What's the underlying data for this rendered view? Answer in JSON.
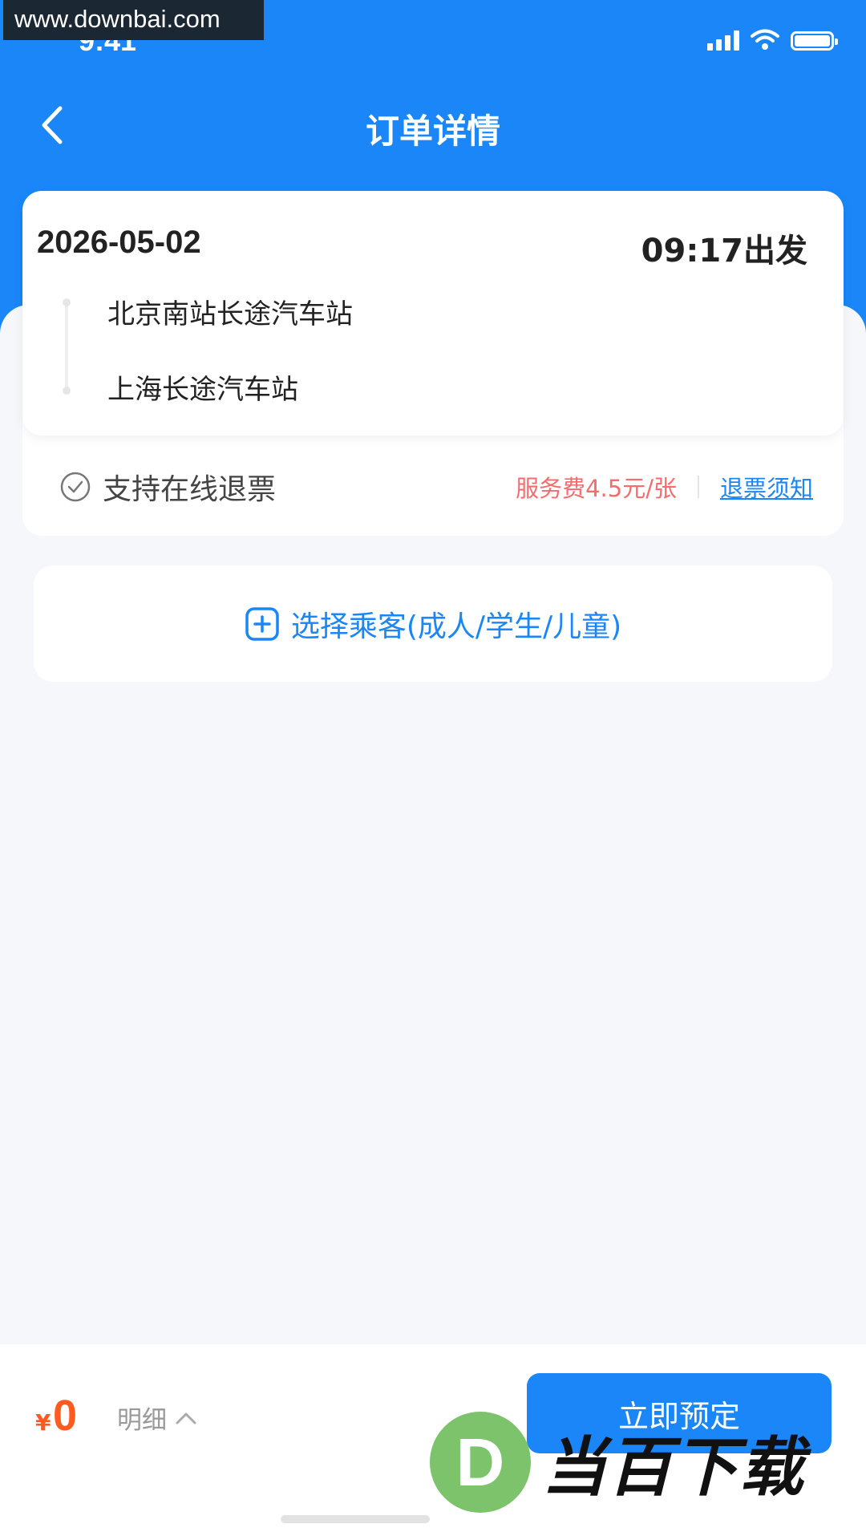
{
  "watermark": "www.downbai.com",
  "status_bar": {
    "time": "9:41"
  },
  "header": {
    "title": "订单详情"
  },
  "trip": {
    "date": "2026-05-02",
    "departure": "09:17出发",
    "from_station": "北京南站长途汽车站",
    "to_station": "上海长途汽车站"
  },
  "refund": {
    "label": "支持在线退票",
    "fee": "服务费4.5元/张",
    "notice_link": "退票须知"
  },
  "passenger": {
    "label": "选择乘客(成人/学生/儿童)"
  },
  "bottom_bar": {
    "currency": "¥",
    "total": "0",
    "detail_label": "明细",
    "book_label": "立即预定"
  },
  "site_logo": {
    "mark": "D",
    "text": "当百下载"
  },
  "colors": {
    "primary": "#1a86f7",
    "price": "#ff5a1f",
    "fee": "#f56c6c",
    "logo_green": "#7cc36b"
  },
  "icons": [
    "back-chevron-icon",
    "signal-icon",
    "wifi-icon",
    "battery-icon",
    "check-circle-icon",
    "plus-square-icon",
    "chevron-up-icon"
  ]
}
